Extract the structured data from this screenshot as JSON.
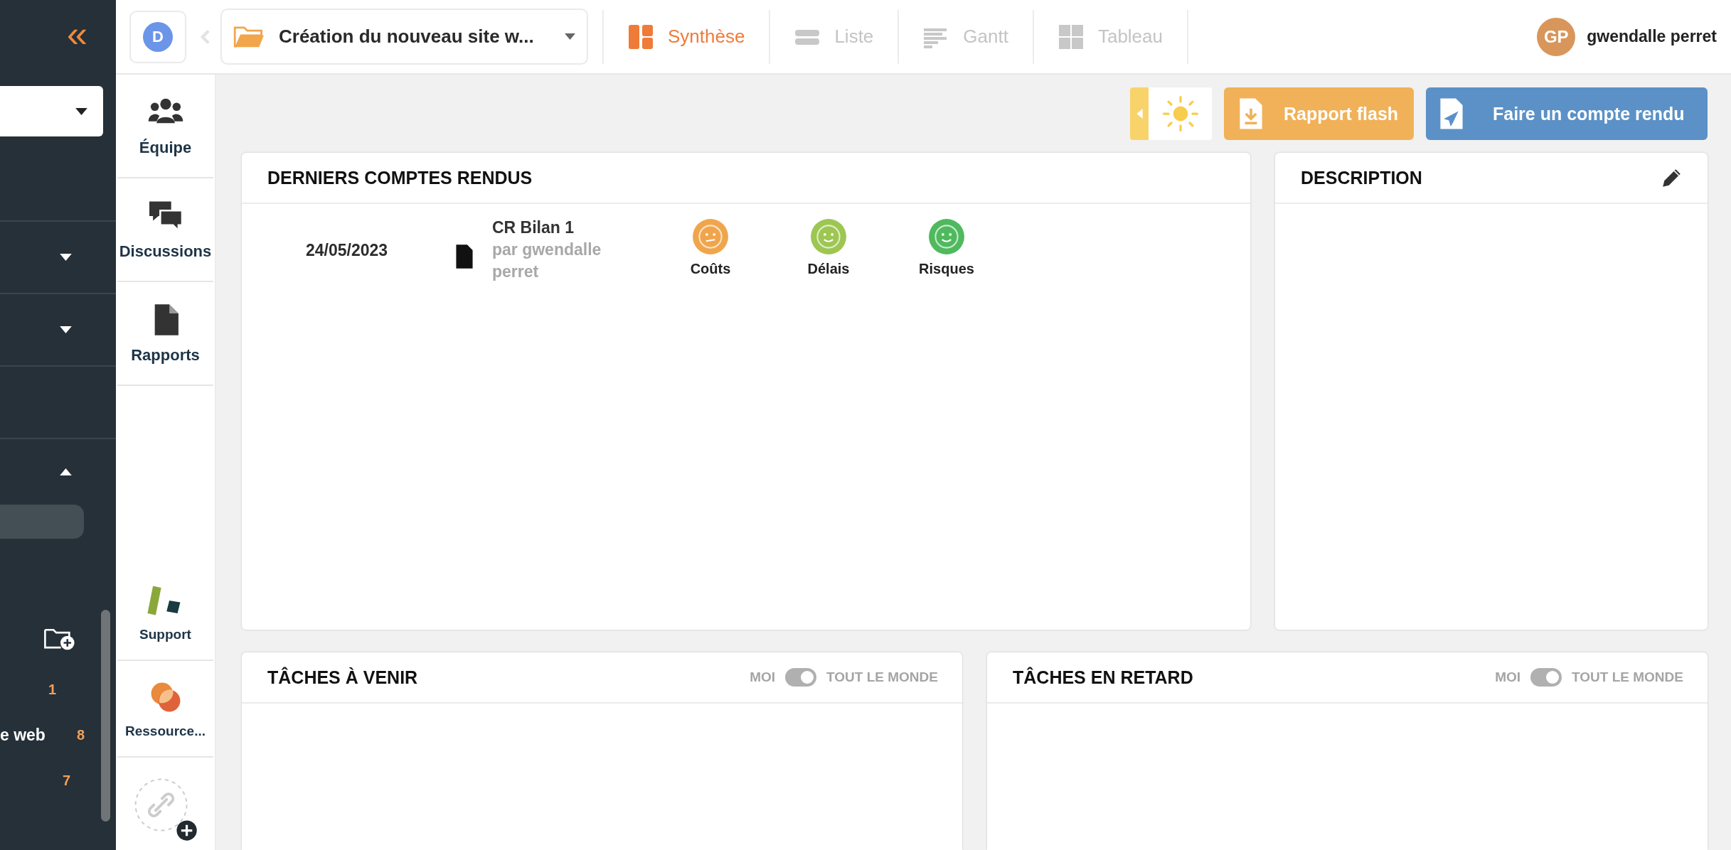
{
  "sidebar": {
    "collapse_button": "«",
    "sections": [
      {
        "kind": "collapsible",
        "expanded": false
      },
      {
        "kind": "collapsible",
        "expanded": false
      },
      {
        "kind": "plain"
      },
      {
        "kind": "collapsible",
        "expanded": true
      }
    ],
    "projects": [
      {
        "count": "1"
      },
      {
        "label": "e web",
        "count": "8"
      },
      {
        "count": "7"
      }
    ]
  },
  "workspace": {
    "initial": "D"
  },
  "weather_panel": {
    "expanded": false
  },
  "project": {
    "title": "Création du nouveau site w..."
  },
  "tabs": [
    {
      "kind": "synthesis",
      "label": "Synthèse",
      "selected": true
    },
    {
      "kind": "list",
      "label": "Liste",
      "selected": false
    },
    {
      "kind": "gantt",
      "label": "Gantt",
      "selected": false
    },
    {
      "kind": "board",
      "label": "Tableau",
      "selected": false
    }
  ],
  "user": {
    "initials": "GP",
    "name": "gwendalle perret"
  },
  "nav": [
    {
      "kind": "team",
      "label": "Équipe"
    },
    {
      "kind": "discussions",
      "label": "Discussions"
    },
    {
      "kind": "reports",
      "label": "Rapports"
    }
  ],
  "nav_bottom": [
    {
      "kind": "support",
      "label": "Support"
    },
    {
      "kind": "resources",
      "label": "Ressource..."
    }
  ],
  "actions": [
    {
      "kind": "flash",
      "label": "Rapport flash"
    },
    {
      "kind": "report",
      "label": "Faire un compte rendu"
    }
  ],
  "reports_card": {
    "title": "DERNIERS COMPTES RENDUS",
    "rows": [
      {
        "date": "24/05/2023",
        "name": "CR Bilan 1",
        "author": "par gwendalle perret",
        "indicators": [
          {
            "label": "Coûts",
            "kind": "neutral",
            "color": "#f0a54c"
          },
          {
            "label": "Délais",
            "kind": "happy",
            "color": "#9dc652"
          },
          {
            "label": "Risques",
            "kind": "happy",
            "color": "#4fb95e"
          }
        ]
      }
    ]
  },
  "description_card": {
    "title": "DESCRIPTION"
  },
  "task_cards": [
    {
      "title": "TÂCHES À VENIR",
      "left": "MOI",
      "right": "TOUT LE MONDE",
      "on": true
    },
    {
      "title": "TÂCHES EN RETARD",
      "left": "MOI",
      "right": "TOUT LE MONDE",
      "on": true
    }
  ]
}
